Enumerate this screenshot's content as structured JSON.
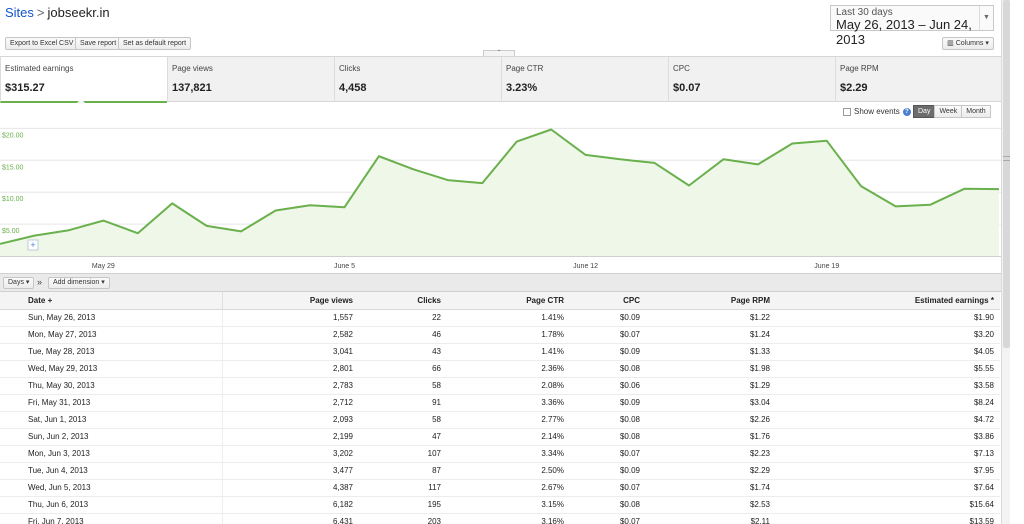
{
  "breadcrumb": {
    "sites": "Sites",
    "separator": ">",
    "site": "jobseekr.in"
  },
  "date_range": {
    "label": "Last 30 days",
    "value": "May 26, 2013 – Jun 24, 2013"
  },
  "toolbar": {
    "export": "Export to Excel CSV",
    "save": "Save report",
    "default": "Set as default report",
    "columns": "Columns"
  },
  "metrics": [
    {
      "label": "Estimated earnings",
      "value": "$315.27"
    },
    {
      "label": "Page views",
      "value": "137,821"
    },
    {
      "label": "Clicks",
      "value": "4,458"
    },
    {
      "label": "Page CTR",
      "value": "3.23%"
    },
    {
      "label": "CPC",
      "value": "$0.07"
    },
    {
      "label": "Page RPM",
      "value": "$2.29"
    }
  ],
  "chart_controls": {
    "show_events": "Show events",
    "help": "?",
    "granularity": [
      "Day",
      "Week",
      "Month"
    ],
    "selected": "Day"
  },
  "chart_data": {
    "type": "area",
    "y_ticks": [
      "$20.00",
      "$15.00",
      "$10.00",
      "$5.00"
    ],
    "y_tick_values": [
      20,
      15,
      10,
      5
    ],
    "ylim": [
      0,
      21
    ],
    "x_tick_labels": [
      "May 29",
      "June 5",
      "June 12",
      "June 19"
    ],
    "x_tick_days": [
      3,
      10,
      17,
      24
    ],
    "series": [
      {
        "values": [
          1.9,
          3.2,
          4.05,
          5.55,
          3.58,
          8.24,
          4.72,
          3.86,
          7.13,
          7.95,
          7.64,
          15.64,
          13.59,
          11.89,
          11.43,
          17.93,
          19.83,
          15.85,
          15.15,
          14.59,
          11.05,
          15.16,
          14.35,
          17.63,
          18.05,
          10.93,
          7.77,
          8.03,
          10.55,
          10.49
        ],
        "color": "#6ab04c"
      }
    ],
    "line_color": "#6ab04c",
    "fill_color": "#eef7e8"
  },
  "table_tools": {
    "days": "Days",
    "add_dimension": "Add dimension"
  },
  "table": {
    "headers": [
      "Date",
      "Page views",
      "Clicks",
      "Page CTR",
      "CPC",
      "Page RPM",
      "Estimated earnings"
    ],
    "sort_marker": "+",
    "earnings_marker": "*",
    "rows": [
      [
        "Sun, May 26, 2013",
        "1,557",
        "22",
        "1.41%",
        "$0.09",
        "$1.22",
        "$1.90"
      ],
      [
        "Mon, May 27, 2013",
        "2,582",
        "46",
        "1.78%",
        "$0.07",
        "$1.24",
        "$3.20"
      ],
      [
        "Tue, May 28, 2013",
        "3,041",
        "43",
        "1.41%",
        "$0.09",
        "$1.33",
        "$4.05"
      ],
      [
        "Wed, May 29, 2013",
        "2,801",
        "66",
        "2.36%",
        "$0.08",
        "$1.98",
        "$5.55"
      ],
      [
        "Thu, May 30, 2013",
        "2,783",
        "58",
        "2.08%",
        "$0.06",
        "$1.29",
        "$3.58"
      ],
      [
        "Fri, May 31, 2013",
        "2,712",
        "91",
        "3.36%",
        "$0.09",
        "$3.04",
        "$8.24"
      ],
      [
        "Sat, Jun 1, 2013",
        "2,093",
        "58",
        "2.77%",
        "$0.08",
        "$2.26",
        "$4.72"
      ],
      [
        "Sun, Jun 2, 2013",
        "2,199",
        "47",
        "2.14%",
        "$0.08",
        "$1.76",
        "$3.86"
      ],
      [
        "Mon, Jun 3, 2013",
        "3,202",
        "107",
        "3.34%",
        "$0.07",
        "$2.23",
        "$7.13"
      ],
      [
        "Tue, Jun 4, 2013",
        "3,477",
        "87",
        "2.50%",
        "$0.09",
        "$2.29",
        "$7.95"
      ],
      [
        "Wed, Jun 5, 2013",
        "4,387",
        "117",
        "2.67%",
        "$0.07",
        "$1.74",
        "$7.64"
      ],
      [
        "Thu, Jun 6, 2013",
        "6,182",
        "195",
        "3.15%",
        "$0.08",
        "$2.53",
        "$15.64"
      ],
      [
        "Fri, Jun 7, 2013",
        "6,431",
        "203",
        "3.16%",
        "$0.07",
        "$2.11",
        "$13.59"
      ]
    ]
  }
}
